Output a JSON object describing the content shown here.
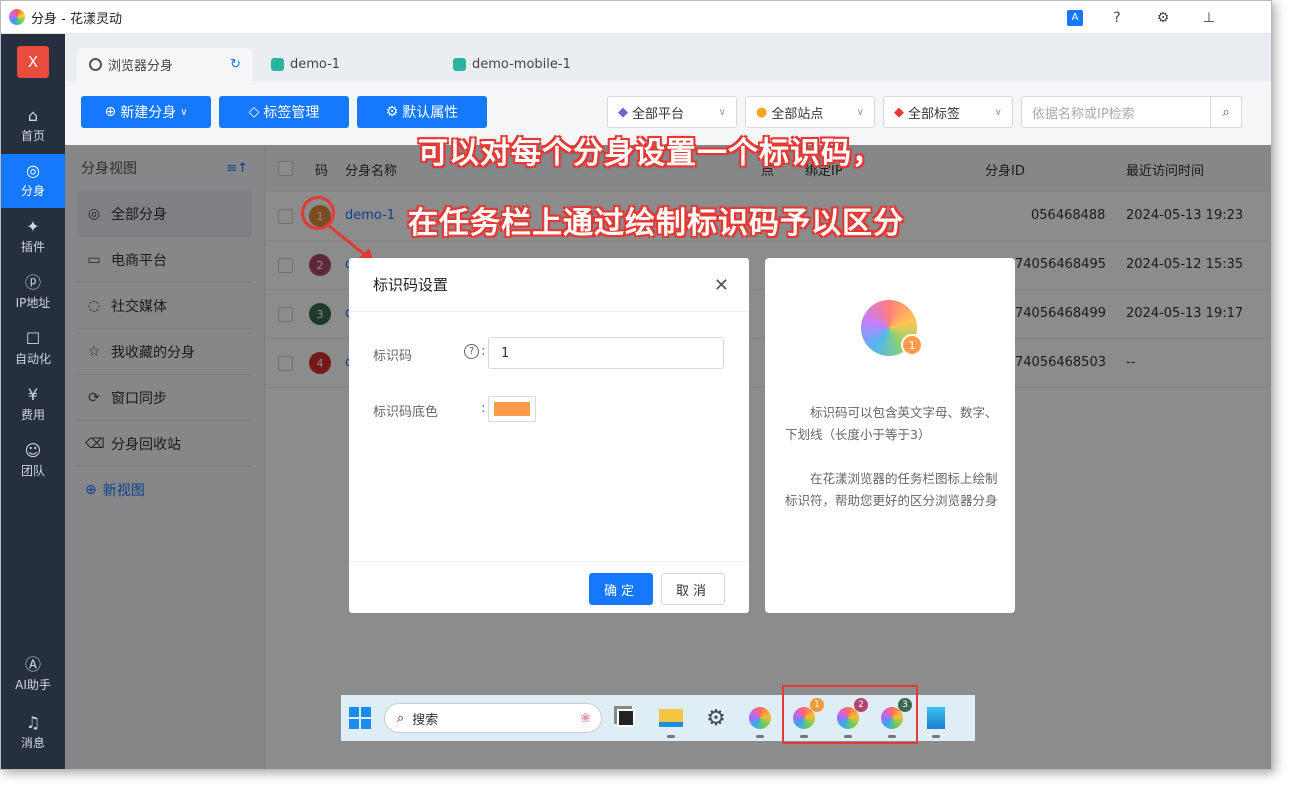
{
  "window": {
    "title": "分身 - 花漾灵动"
  },
  "leftnav": {
    "close_label": "X",
    "items": [
      {
        "label": "首页",
        "icon": "home-icon"
      },
      {
        "label": "分身",
        "icon": "browser-icon"
      },
      {
        "label": "插件",
        "icon": "plugin-icon"
      },
      {
        "label": "IP地址",
        "icon": "ip-icon"
      },
      {
        "label": "自动化",
        "icon": "robot-icon"
      },
      {
        "label": "费用",
        "icon": "yuan-icon"
      },
      {
        "label": "团队",
        "icon": "team-icon"
      },
      {
        "label": "AI助手",
        "icon": "ai-icon"
      },
      {
        "label": "消息",
        "icon": "bell-icon"
      }
    ]
  },
  "tabs": [
    {
      "label": "浏览器分身"
    },
    {
      "label": "demo-1"
    },
    {
      "label": "demo-mobile-1"
    }
  ],
  "toolbar": {
    "new_label": "新建分身",
    "tags_label": "标签管理",
    "defaults_label": "默认属性",
    "platform_label": "全部平台",
    "site_label": "全部站点",
    "tag_filter_label": "全部标签",
    "search_placeholder": "依据名称或IP检索"
  },
  "sidebar": {
    "title": "分身视图",
    "items": [
      {
        "label": "全部分身"
      },
      {
        "label": "电商平台"
      },
      {
        "label": "社交媒体"
      },
      {
        "label": "我收藏的分身"
      },
      {
        "label": "窗口同步"
      },
      {
        "label": "分身回收站"
      }
    ],
    "new_view_label": "新视图"
  },
  "table": {
    "headers": {
      "code": "码",
      "name": "分身名称",
      "site": "点",
      "ip": "绑定IP",
      "id": "分身ID",
      "last_visit": "最近访问时间"
    },
    "rows": [
      {
        "code": "1",
        "color": "#e08a3c",
        "name": "demo-1",
        "id": "056468488",
        "time": "2024-05-13 19:23"
      },
      {
        "code": "2",
        "color": "#b0466e",
        "name": "d",
        "id": "74056468495",
        "time": "2024-05-12 15:35"
      },
      {
        "code": "3",
        "color": "#3a6b4f",
        "name": "d",
        "id": "74056468499",
        "time": "2024-05-13 19:17"
      },
      {
        "code": "4",
        "color": "#d32f2f",
        "name": "d",
        "id": "74056468503",
        "time": "--"
      }
    ]
  },
  "annotation": {
    "line1": "可以对每个分身设置一个标识码，",
    "line2": "在任务栏上通过绘制标识码予以区分"
  },
  "dialog": {
    "title": "标识码设置",
    "code_label": "标识码",
    "code_value": "1",
    "color_label": "标识码底色",
    "color_value": "#ff9a4d",
    "ok_label": "确定",
    "cancel_label": "取消"
  },
  "info": {
    "text1": "标识码可以包含英文字母、数字、下划线（长度小于等于3）",
    "text2": "在花漾浏览器的任务栏图标上绘制标识符，帮助您更好的区分浏览器分身",
    "badge": "1"
  },
  "taskbar": {
    "search_label": "搜索",
    "badges": [
      "1",
      "2",
      "3"
    ]
  }
}
